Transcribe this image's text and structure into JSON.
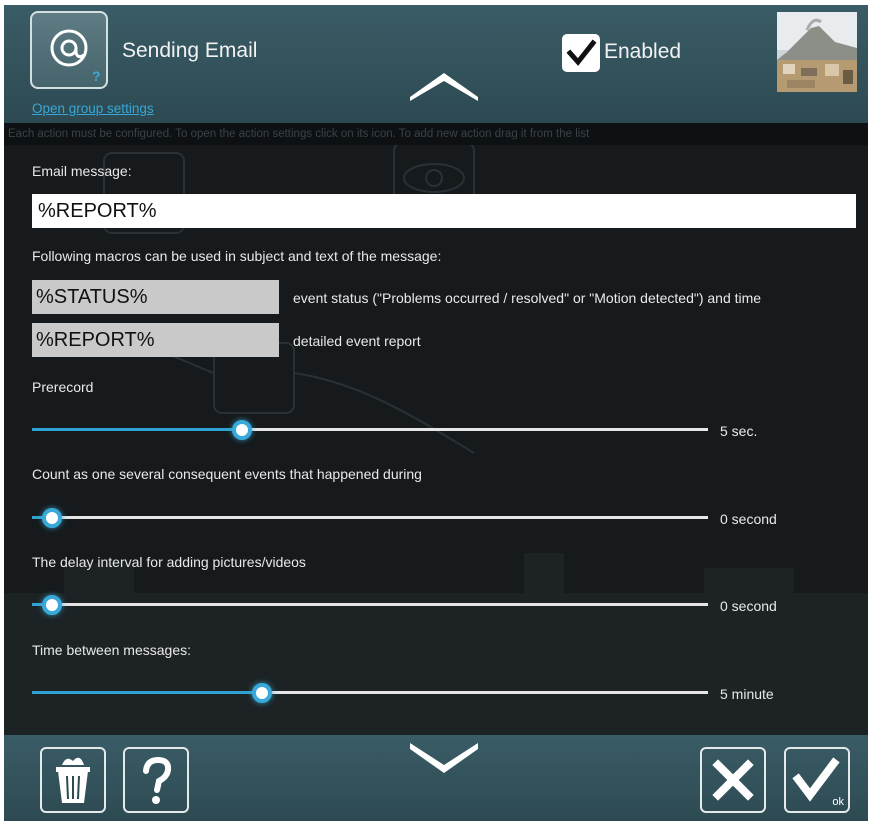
{
  "header": {
    "title": "Sending Email",
    "group_settings_link": "Open group settings",
    "enabled_label": "Enabled",
    "enabled_checked": true
  },
  "info_strip_text": "Each action must be configured. To open the action settings click on its icon. To add new action drag it from the list",
  "email": {
    "label": "Email message:",
    "value": "%REPORT%"
  },
  "macros": {
    "intro": "Following macros can be used in subject and text of the message:",
    "items": [
      {
        "name": "%STATUS%",
        "description": "event status (\"Problems occurred / resolved\" or \"Motion detected\") and time"
      },
      {
        "name": "%REPORT%",
        "description": "detailed event report"
      }
    ]
  },
  "sliders": [
    {
      "label": "Prerecord",
      "value_text": "5 sec.",
      "position": 0.31
    },
    {
      "label": "Count as one several consequent events that happened during",
      "value_text": "0 second",
      "position": 0.03
    },
    {
      "label": "The delay interval for adding pictures/videos",
      "value_text": "0 second",
      "position": 0.03
    },
    {
      "label": "Time between messages:",
      "value_text": "5 minute",
      "position": 0.34
    }
  ],
  "footer": {
    "ok_sublabel": "ok"
  },
  "colors": {
    "panel": "#34545d",
    "accent": "#30a3d4",
    "link": "#38a7d7",
    "background": "#161a1c"
  },
  "icons": [
    "at-sign-icon",
    "chevron-up-icon",
    "checkmark-icon",
    "trash-icon",
    "help-icon",
    "close-icon",
    "chevron-down-icon"
  ]
}
